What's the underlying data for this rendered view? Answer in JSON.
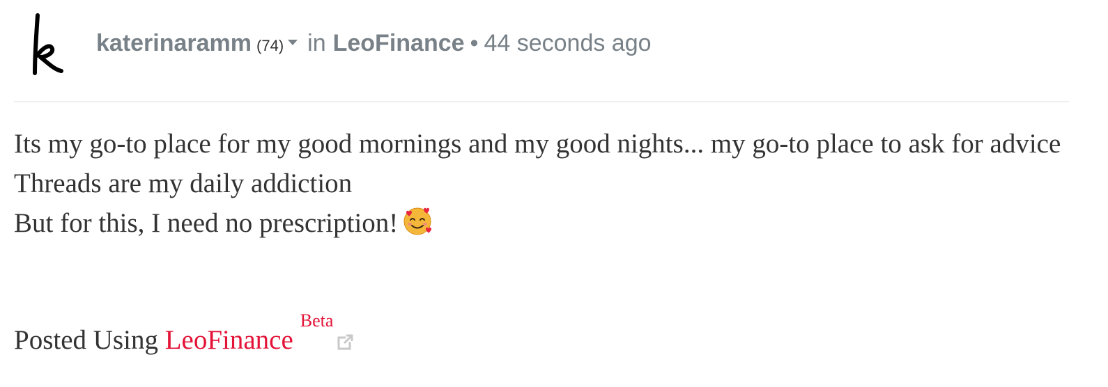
{
  "post": {
    "author": {
      "name": "katerinaramm",
      "reputation": "(74)",
      "avatar_icon": "handwritten-k-avatar-icon",
      "menu_icon": "caret-down-icon"
    },
    "in_word": "in",
    "community": "LeoFinance",
    "separator": "•",
    "timestamp": "44 seconds ago",
    "body": {
      "line1": "Its my go-to place for my good mornings and my good nights... my go-to place to ask for advice",
      "line2": "Threads are my daily addiction",
      "line3": "But for this, I need no prescription!",
      "emoji_icon": "smiling-face-with-hearts-icon"
    },
    "footer": {
      "prefix": "Posted Using",
      "link_text": "LeoFinance",
      "badge": "Beta",
      "external_icon": "external-link-icon"
    }
  },
  "colors": {
    "meta_text": "#788187",
    "body_text": "#333333",
    "link_red": "#e31337",
    "divider": "#eeeeee"
  }
}
